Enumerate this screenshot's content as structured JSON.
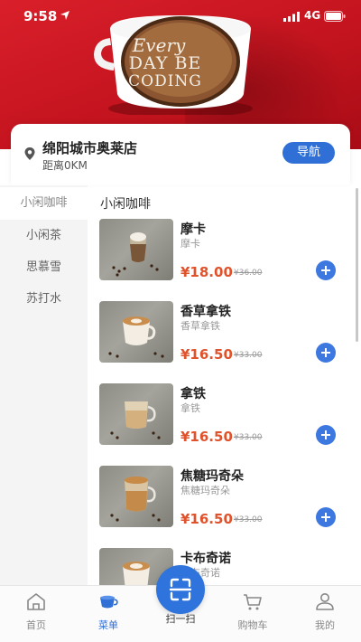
{
  "status_bar": {
    "time": "9:58",
    "network": "4G"
  },
  "banner": {
    "line1": "Every",
    "line2": "DAY BE",
    "line3": "CODING"
  },
  "store": {
    "name": "绵阳城市奥莱店",
    "distance": "距离0KM",
    "nav_label": "导航"
  },
  "categories": [
    {
      "label": "小闲咖啡",
      "active": true
    },
    {
      "label": "小闲茶",
      "active": false
    },
    {
      "label": "思慕雪",
      "active": false
    },
    {
      "label": "苏打水",
      "active": false
    }
  ],
  "section_title": "小闲咖啡",
  "products": [
    {
      "name": "摩卡",
      "subtitle": "摩卡",
      "price": "¥18.00",
      "old_price": "¥36.00",
      "cup": "mocha"
    },
    {
      "name": "香草拿铁",
      "subtitle": "香草拿铁",
      "price": "¥16.50",
      "old_price": "¥33.00",
      "cup": "latte-art"
    },
    {
      "name": "拿铁",
      "subtitle": "拿铁",
      "price": "¥16.50",
      "old_price": "¥33.00",
      "cup": "glass-latte"
    },
    {
      "name": "焦糖玛奇朵",
      "subtitle": "焦糖玛奇朵",
      "price": "¥16.50",
      "old_price": "¥33.00",
      "cup": "macchiato"
    },
    {
      "name": "卡布奇诺",
      "subtitle": "卡布奇诺",
      "price": "",
      "old_price": "",
      "cup": "cappuccino"
    }
  ],
  "tabbar": {
    "home": "首页",
    "menu": "菜单",
    "scan": "扫一扫",
    "cart": "购物车",
    "mine": "我的"
  },
  "colors": {
    "brand_red": "#c4141f",
    "accent_blue": "#2f6fd6",
    "price_orange": "#e0522b"
  }
}
